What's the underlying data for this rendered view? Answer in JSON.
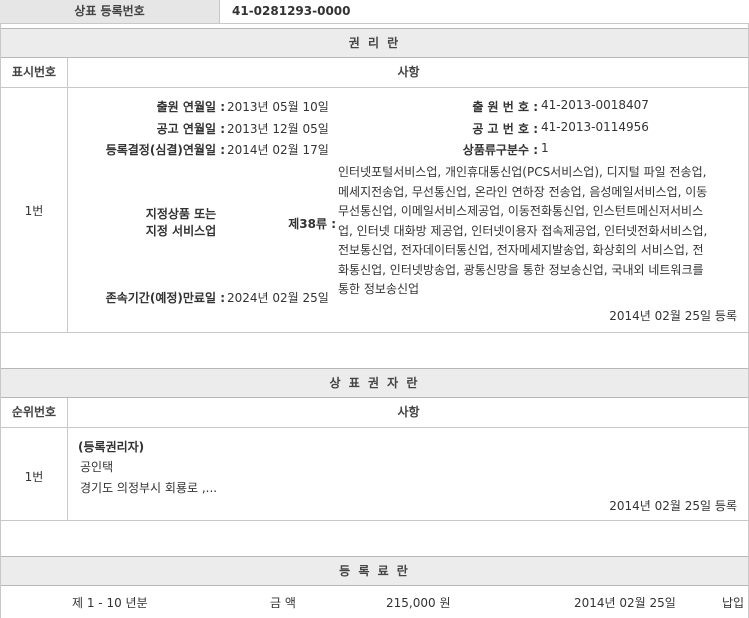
{
  "registration": {
    "label": "상표 등록번호",
    "number": "41-0281293-0000"
  },
  "rights_section": {
    "title": "권 리 란",
    "col_index": "표시번호",
    "col_content": "사항",
    "row_index": "1번",
    "application_date_label": "출원 연월일 :",
    "application_date": "2013년 05월 10일",
    "application_no_label": "출 원 번 호 :",
    "application_no": "41-2013-0018407",
    "publication_date_label": "공고 연월일 :",
    "publication_date": "2013년 12월 05일",
    "publication_no_label": "공 고 번 호 :",
    "publication_no": "41-2013-0114956",
    "decision_date_label": "등록결정(심결)연월일 :",
    "decision_date": "2014년 02월 17일",
    "class_count_label": "상품류구분수 :",
    "class_count": "1",
    "designated_label_1": "지정상품 또는",
    "designated_label_2": "지정 서비스업",
    "class_label": "제38류 :",
    "designated_lines": [
      "인터넷포털서비스업, 개인휴대통신업(PCS서비스업), 디지털 파일 전송업,",
      "메세지전송업, 무선통신업, 온라인 연하장 전송업, 음성메일서비스업, 이동",
      "무선통신업, 이메일서비스제공업, 이동전화통신업, 인스턴트메신저서비스",
      "업, 인터넷 대화방 제공업, 인터넷이용자 접속제공업, 인터넷전화서비스업,",
      "전보통신업, 전자데이터통신업, 전자메세지발송업, 화상회의 서비스업, 전",
      "화통신업, 인터넷방송업, 광통신망을 통한 정보송신업, 국내외 네트워크를",
      "통한 정보송신업"
    ],
    "expiry_label": "존속기간(예정)만료일 :",
    "expiry_date": "2024년 02월 25일",
    "registered_note": "2014년 02월 25일 등록"
  },
  "owner_section": {
    "title": "상 표 권 자 란",
    "col_index": "순위번호",
    "col_content": "사항",
    "row_index": "1번",
    "role": "(등록권리자)",
    "name": "공인택",
    "address": "경기도 의정부시 회룡로 ,...",
    "registered_note": "2014년 02월 25일 등록"
  },
  "fee_section": {
    "title": "등 록 료 란",
    "period": "제 1 - 10 년분",
    "amount_label": "금 액",
    "amount": "215,000 원",
    "date": "2014년 02월 25일",
    "status": "납입"
  }
}
